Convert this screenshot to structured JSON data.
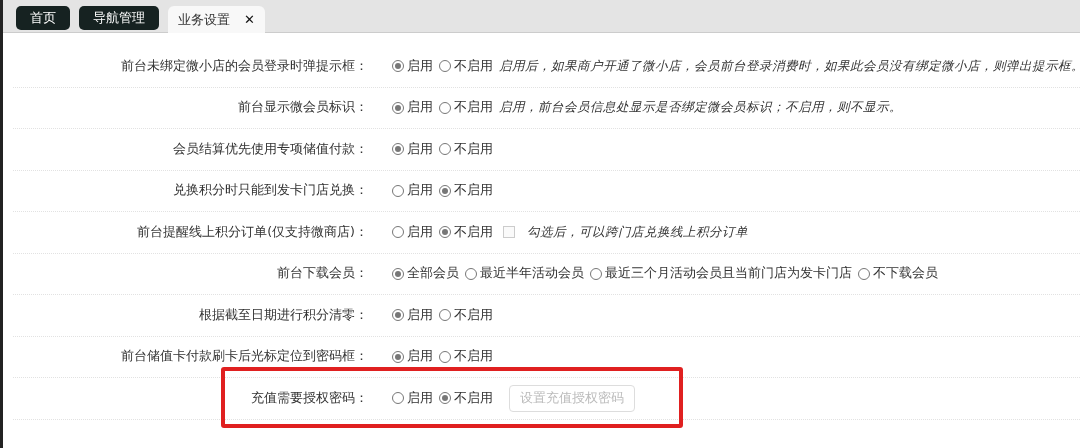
{
  "tabs": [
    {
      "label": "首页",
      "selected": false,
      "closable": false
    },
    {
      "label": "导航管理",
      "selected": false,
      "closable": false
    },
    {
      "label": "业务设置",
      "selected": true,
      "closable": true,
      "close_glyph": "✕"
    }
  ],
  "settings": [
    {
      "label": "前台未绑定微小店的会员登录时弹提示框：",
      "options": [
        {
          "label": "启用",
          "selected": true
        },
        {
          "label": "不启用",
          "selected": false
        }
      ],
      "note": "启用后，如果商户开通了微小店，会员前台登录消费时，如果此会员没有绑定微小店，则弹出提示框。",
      "highlighted": false
    },
    {
      "label": "前台显示微会员标识：",
      "options": [
        {
          "label": "启用",
          "selected": true
        },
        {
          "label": "不启用",
          "selected": false
        }
      ],
      "note": "启用，前台会员信息处显示是否绑定微会员标识；不启用，则不显示。",
      "highlighted": false
    },
    {
      "label": "会员结算优先使用专项储值付款：",
      "options": [
        {
          "label": "启用",
          "selected": true
        },
        {
          "label": "不启用",
          "selected": false
        }
      ],
      "highlighted": false
    },
    {
      "label": "兑换积分时只能到发卡门店兑换：",
      "options": [
        {
          "label": "启用",
          "selected": false
        },
        {
          "label": "不启用",
          "selected": true
        }
      ],
      "highlighted": false
    },
    {
      "label": "前台提醒线上积分订单(仅支持微商店)：",
      "options": [
        {
          "label": "启用",
          "selected": false
        },
        {
          "label": "不启用",
          "selected": true
        }
      ],
      "checkbox": {
        "checked": false
      },
      "note": "勾选后，可以跨门店兑换线上积分订单",
      "highlighted": false
    },
    {
      "label": "前台下载会员：",
      "options": [
        {
          "label": "全部会员",
          "selected": true
        },
        {
          "label": "最近半年活动会员",
          "selected": false
        },
        {
          "label": "最近三个月活动会员且当前门店为发卡门店",
          "selected": false
        },
        {
          "label": "不下载会员",
          "selected": false
        }
      ],
      "highlighted": false
    },
    {
      "label": "根据截至日期进行积分清零：",
      "options": [
        {
          "label": "启用",
          "selected": true
        },
        {
          "label": "不启用",
          "selected": false
        }
      ],
      "highlighted": false
    },
    {
      "label": "前台储值卡付款刷卡后光标定位到密码框：",
      "options": [
        {
          "label": "启用",
          "selected": true
        },
        {
          "label": "不启用",
          "selected": false
        }
      ],
      "highlighted": false
    },
    {
      "label": "充值需要授权密码：",
      "options": [
        {
          "label": "启用",
          "selected": false
        },
        {
          "label": "不启用",
          "selected": true
        }
      ],
      "button": {
        "label": "设置充值授权密码",
        "disabled": true
      },
      "highlighted": true
    }
  ]
}
